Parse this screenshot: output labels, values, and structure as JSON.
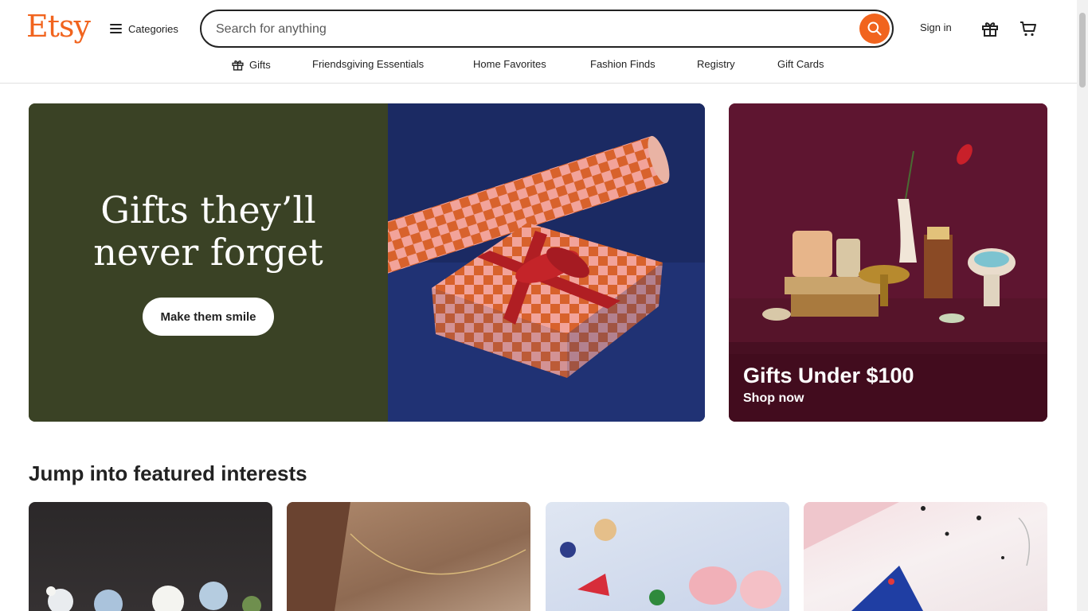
{
  "header": {
    "logo": "Etsy",
    "categories_label": "Categories",
    "search_placeholder": "Search for anything",
    "search_value": "",
    "signin_label": "Sign in",
    "icons": [
      "menu-icon",
      "search-icon",
      "gift-icon",
      "cart-icon"
    ]
  },
  "nav": {
    "items": [
      {
        "label": "Gifts",
        "icon": "gift-icon"
      },
      {
        "label": "Friendsgiving Essentials"
      },
      {
        "label": "Home Favorites"
      },
      {
        "label": "Fashion Finds"
      },
      {
        "label": "Registry"
      },
      {
        "label": "Gift Cards"
      }
    ]
  },
  "hero": {
    "title_line1": "Gifts they’ll",
    "title_line2": "never forget",
    "cta_label": "Make them smile",
    "side_title": "Gifts Under $100",
    "side_sub": "Shop now"
  },
  "featured": {
    "title": "Jump into featured interests"
  },
  "colors": {
    "brand": "#f1641e",
    "hero_green": "#3a4225",
    "hero_navy": "#1f3172",
    "side_burgundy": "#6a1a33"
  }
}
